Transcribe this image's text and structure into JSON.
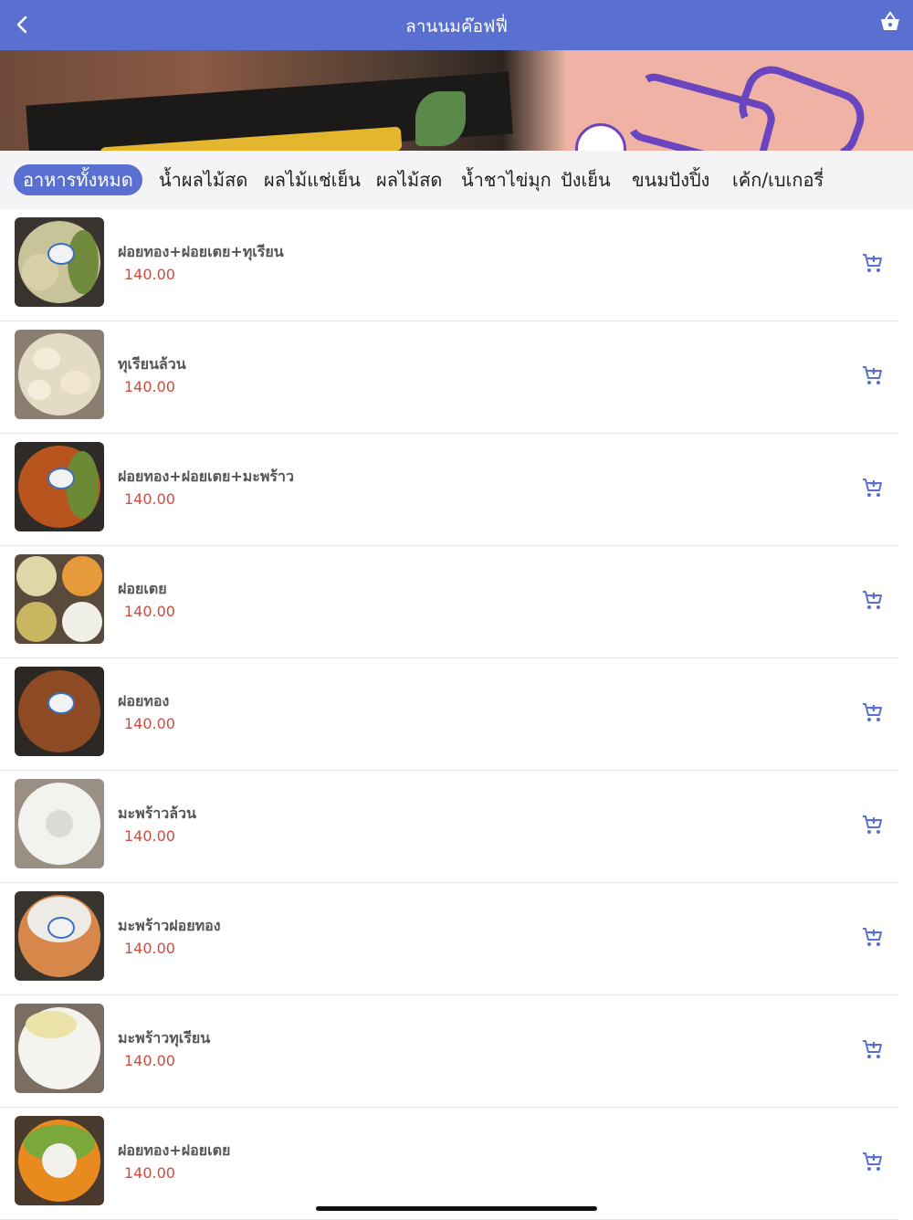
{
  "header": {
    "title": "ลานนมค๊อฟฟี่"
  },
  "icons": {
    "back": "chevron-left-icon",
    "basket": "basket-icon",
    "add_cart": "add-to-cart-icon"
  },
  "colors": {
    "accent": "#5a70d0",
    "price": "#d24a3e"
  },
  "tabs": [
    {
      "label": "อาหารทั้งหมด",
      "active": true
    },
    {
      "label": "น้ำผลไม้สด",
      "active": false
    },
    {
      "label": "ผลไม้แช่เย็น",
      "active": false
    },
    {
      "label": "ผลไม้สด",
      "active": false
    },
    {
      "label": "น้ำชาไข่มุก",
      "active": false
    },
    {
      "label": "ปังเย็น",
      "active": false
    },
    {
      "label": "ขนมปังปิ้ง",
      "active": false
    },
    {
      "label": "เค้ก/เบเกอรี่",
      "active": false
    }
  ],
  "products": [
    {
      "name": "ฝอยทอง+ฝอยเตย+ทุเรียน",
      "price": "140.00"
    },
    {
      "name": "ทุเรียนล้วน",
      "price": "140.00"
    },
    {
      "name": "ฝอยทอง+ฝอยเตย+มะพร้าว",
      "price": "140.00"
    },
    {
      "name": "ฝอยเตย",
      "price": "140.00"
    },
    {
      "name": "ฝอยทอง",
      "price": "140.00"
    },
    {
      "name": "มะพร้าวล้วน",
      "price": "140.00"
    },
    {
      "name": "มะพร้าวฝอยทอง",
      "price": "140.00"
    },
    {
      "name": "มะพร้าวทุเรียน",
      "price": "140.00"
    },
    {
      "name": "ฝอยทอง+ฝอยเตย",
      "price": "140.00"
    }
  ]
}
